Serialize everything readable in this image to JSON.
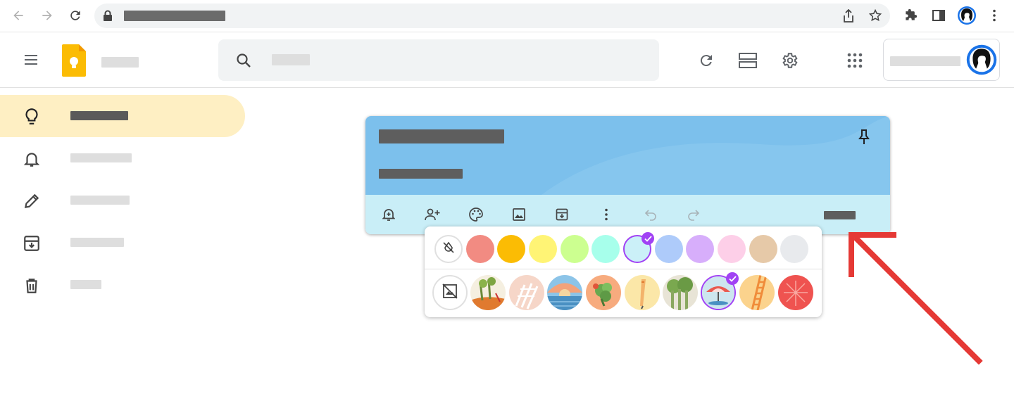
{
  "browser": {
    "address_bar": "",
    "icons": [
      "back-arrow-icon",
      "forward-arrow-icon",
      "reload-icon",
      "lock-icon",
      "share-icon",
      "star-icon",
      "extensions-icon",
      "side-panel-icon",
      "profile-icon",
      "kebab-menu-icon"
    ]
  },
  "app": {
    "title": "",
    "search_placeholder": "",
    "account_name": "",
    "header_icons": [
      "main-menu-icon",
      "refresh-icon",
      "list-view-icon",
      "settings-icon",
      "apps-grid-icon"
    ]
  },
  "sidebar": {
    "items": [
      {
        "icon": "lightbulb-icon",
        "label": "",
        "active": true
      },
      {
        "icon": "bell-icon",
        "label": "",
        "active": false
      },
      {
        "icon": "pencil-icon",
        "label": "",
        "active": false
      },
      {
        "icon": "archive-icon",
        "label": "",
        "active": false
      },
      {
        "icon": "trash-icon",
        "label": "",
        "active": false
      }
    ]
  },
  "note": {
    "title": "",
    "body": "",
    "close_label": "",
    "background_color": "#7cc0ec",
    "toolbar_color": "#c9eef7",
    "toolbar_icons": [
      "remind-icon",
      "collaborator-icon",
      "palette-icon",
      "image-icon",
      "archive-icon",
      "more-icon",
      "undo-icon",
      "redo-icon"
    ]
  },
  "palette": {
    "colors": [
      {
        "name": "default",
        "hex": "#ffffff"
      },
      {
        "name": "coral",
        "hex": "#f28b82"
      },
      {
        "name": "peach",
        "hex": "#fbbc04"
      },
      {
        "name": "sand",
        "hex": "#fff475"
      },
      {
        "name": "mint",
        "hex": "#ccff90"
      },
      {
        "name": "sage",
        "hex": "#a7ffeb"
      },
      {
        "name": "fog",
        "hex": "#cbf0f8",
        "selected": true
      },
      {
        "name": "storm",
        "hex": "#aecbfa"
      },
      {
        "name": "dusk",
        "hex": "#d7aefb"
      },
      {
        "name": "blossom",
        "hex": "#fdcfe8"
      },
      {
        "name": "clay",
        "hex": "#e6c9a8"
      },
      {
        "name": "chalk",
        "hex": "#e8eaed"
      }
    ],
    "backgrounds": [
      {
        "name": "none"
      },
      {
        "name": "groceries"
      },
      {
        "name": "food"
      },
      {
        "name": "music"
      },
      {
        "name": "recipes"
      },
      {
        "name": "notes"
      },
      {
        "name": "places"
      },
      {
        "name": "travel",
        "selected": true
      },
      {
        "name": "video"
      },
      {
        "name": "celebration"
      }
    ],
    "selected_accent": "#a142f4"
  },
  "annotation": {
    "arrow_color": "#e53935"
  }
}
